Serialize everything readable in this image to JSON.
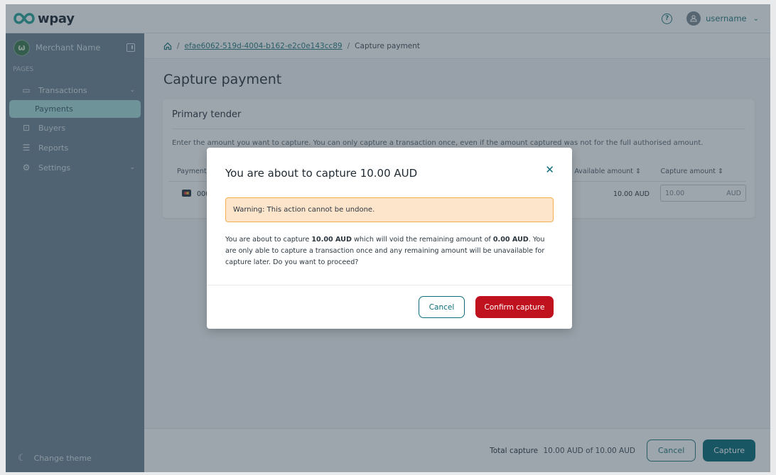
{
  "app": {
    "logo_text": "wpay"
  },
  "topbar": {
    "help_icon": "question-circle-icon",
    "username": "username"
  },
  "sidebar": {
    "merchant_name": "Merchant Name",
    "section_label": "PAGES",
    "items": [
      {
        "label": "Transactions",
        "icon": "credit-card-icon",
        "expandable": true
      },
      {
        "label": "Payments",
        "active": true
      },
      {
        "label": "Buyers",
        "icon": "id-card-icon"
      },
      {
        "label": "Reports",
        "icon": "clipboard-icon"
      },
      {
        "label": "Settings",
        "icon": "gear-icon",
        "expandable": true
      }
    ],
    "change_theme": "Change theme"
  },
  "breadcrumb": {
    "sep": "/",
    "link": "efae6062-519d-4004-b162-e2c0e143cc89",
    "current": "Capture payment"
  },
  "page": {
    "title": "Capture payment",
    "card": {
      "title": "Primary tender",
      "description": "Enter the amount you want to capture. You can only capture a transaction once, even if the amount captured was not for the full authorised amount.",
      "columns": [
        "Payment method",
        "Available amount",
        "Capture amount"
      ],
      "row": {
        "method_masked": "000",
        "available": "10.00 AUD",
        "capture_value": "10.00",
        "currency": "AUD"
      }
    }
  },
  "footer": {
    "total_label": "Total capture",
    "total_value": "10.00 AUD of 10.00 AUD",
    "cancel": "Cancel",
    "capture": "Capture"
  },
  "modal": {
    "title": "You are about to capture 10.00 AUD",
    "warning": "Warning: This action cannot be undone.",
    "body_1": "You are about to capture ",
    "body_amount": "10.00 AUD",
    "body_2": " which will void the remaining amount of ",
    "body_remaining": "0.00 AUD",
    "body_3": ". You are only able to capture a transaction once and any remaining amount will be unavailable for capture later. Do you want to proceed?",
    "cancel": "Cancel",
    "confirm": "Confirm capture"
  },
  "colors": {
    "brand": "#0c6e78",
    "danger": "#c0121e",
    "warning_bg": "#fde5cc"
  }
}
